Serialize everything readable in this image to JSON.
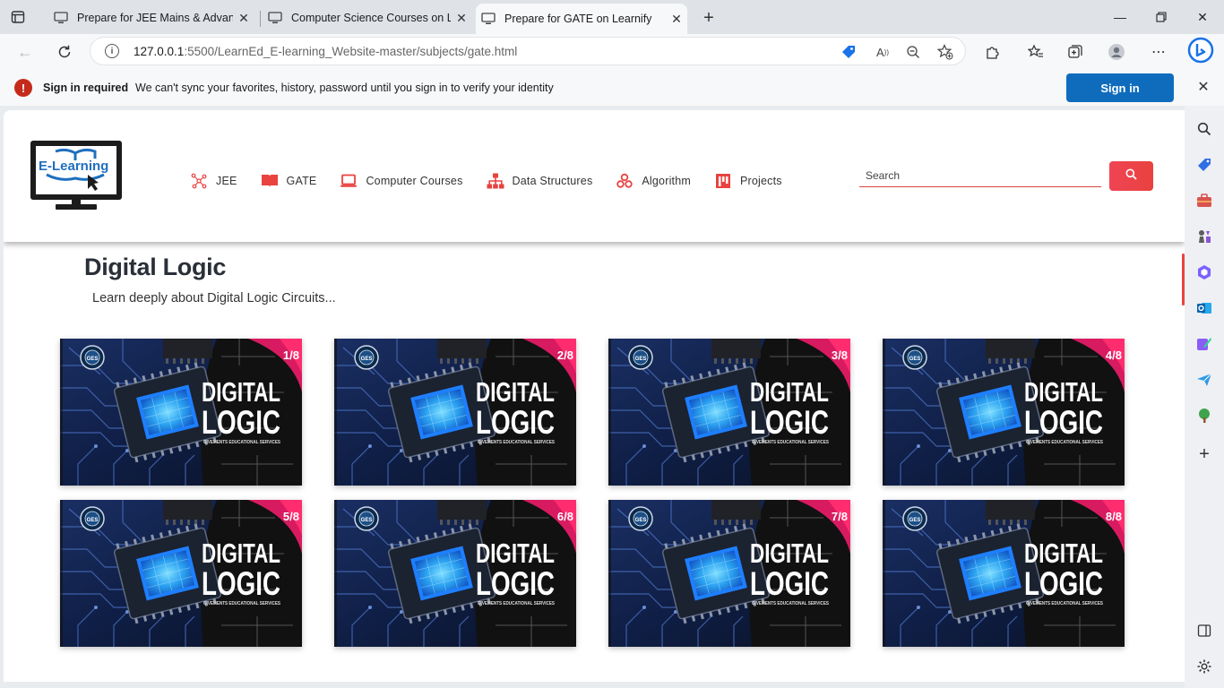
{
  "browser": {
    "tabs": [
      {
        "title": "Prepare for JEE Mains & Advanced",
        "active": false
      },
      {
        "title": "Computer Science Courses on Le",
        "active": false
      },
      {
        "title": "Prepare for GATE on Learnify",
        "active": true
      }
    ],
    "url_host": "127.0.0.1",
    "url_rest": ":5500/LearnEd_E-learning_Website-master/subjects/gate.html"
  },
  "signin_bar": {
    "title": "Sign in required",
    "message": "We can't sync your favorites, history, password until you sign in to verify your identity",
    "button": "Sign in"
  },
  "site": {
    "logo_text": "E-Learning",
    "nav": [
      {
        "label": "JEE",
        "icon": "atom-icon"
      },
      {
        "label": "GATE",
        "icon": "book-icon"
      },
      {
        "label": "Computer Courses",
        "icon": "laptop-icon"
      },
      {
        "label": "Data Structures",
        "icon": "sitemap-icon"
      },
      {
        "label": "Algorithm",
        "icon": "cubes-icon"
      },
      {
        "label": "Projects",
        "icon": "project-icon"
      }
    ],
    "search_placeholder": "Search",
    "accent": "#e9423f"
  },
  "section": {
    "title": "Digital Logic",
    "subtitle": "Learn deeply about Digital Logic Circuits..."
  },
  "cards": [
    {
      "counter": "1/8",
      "line1": "DIGITAL",
      "line2": "LOGIC",
      "caption": "GIVEMENTS EDUCATIONAL SERVICES"
    },
    {
      "counter": "2/8",
      "line1": "DIGITAL",
      "line2": "LOGIC",
      "caption": "GIVEMENTS EDUCATIONAL SERVICES"
    },
    {
      "counter": "3/8",
      "line1": "DIGITAL",
      "line2": "LOGIC",
      "caption": "GIVEMENTS EDUCATIONAL SERVICES"
    },
    {
      "counter": "4/8",
      "line1": "DIGITAL",
      "line2": "LOGIC",
      "caption": "GIVEMENTS EDUCATIONAL SERVICES"
    },
    {
      "counter": "5/8",
      "line1": "DIGITAL",
      "line2": "LOGIC",
      "caption": "GIVEMENTS EDUCATIONAL SERVICES"
    },
    {
      "counter": "6/8",
      "line1": "DIGITAL",
      "line2": "LOGIC",
      "caption": "GIVEMENTS EDUCATIONAL SERVICES"
    },
    {
      "counter": "7/8",
      "line1": "DIGITAL",
      "line2": "LOGIC",
      "caption": "GIVEMENTS EDUCATIONAL SERVICES"
    },
    {
      "counter": "8/8",
      "line1": "DIGITAL",
      "line2": "LOGIC",
      "caption": "GIVEMENTS EDUCATIONAL SERVICES"
    }
  ]
}
